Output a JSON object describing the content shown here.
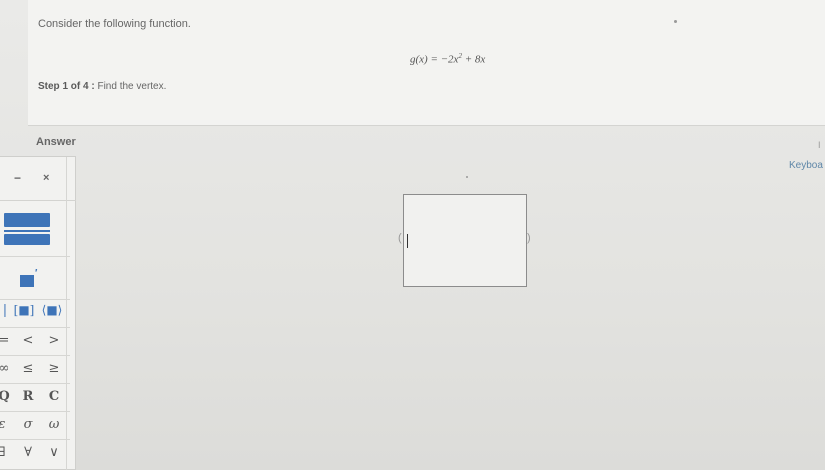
{
  "question": {
    "prompt": "Consider the following function.",
    "equation_lhs": "g(x) = −2x",
    "equation_exp": "2",
    "equation_rhs": " + 8x",
    "step_label": "Step 1 of 4 :",
    "step_text": "Find the vertex."
  },
  "answer": {
    "label": "Answer",
    "keyboard_link": "Keyboa",
    "left_paren": "(",
    "right_paren": ")"
  },
  "palette": {
    "minus": "−",
    "times": "×",
    "row_brackets": [
      "|",
      "[■]",
      "⟨■⟩"
    ],
    "row_compare": [
      "=",
      "<",
      ">"
    ],
    "row_inequality": [
      "∞",
      "≤",
      "≥"
    ],
    "row_sets": [
      "Q",
      "R",
      "C"
    ],
    "row_greek": [
      "ε",
      "σ",
      "ω"
    ],
    "row_logic": [
      "∃",
      "∀",
      "∨"
    ]
  },
  "accent_color": "#3e74b8"
}
